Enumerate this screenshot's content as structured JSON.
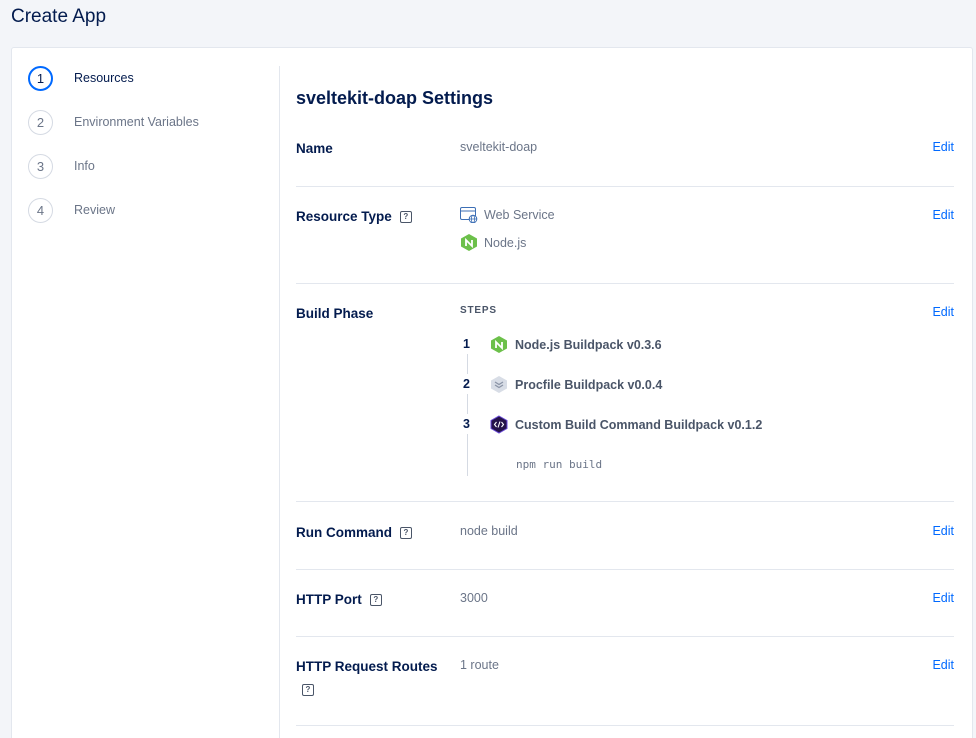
{
  "header": {
    "title": "Create App"
  },
  "wizard": {
    "steps": [
      {
        "number": "1",
        "label": "Resources"
      },
      {
        "number": "2",
        "label": "Environment Variables"
      },
      {
        "number": "3",
        "label": "Info"
      },
      {
        "number": "4",
        "label": "Review"
      }
    ]
  },
  "settings": {
    "title": "sveltekit-doap Settings",
    "edit_label": "Edit",
    "help_glyph": "?",
    "name": {
      "label": "Name",
      "value": "sveltekit-doap"
    },
    "resource_type": {
      "label": "Resource Type",
      "type": "Web Service",
      "runtime": "Node.js"
    },
    "build_phase": {
      "label": "Build Phase",
      "steps_heading": "STEPS",
      "buildpacks": [
        {
          "number": "1",
          "name": "Node.js Buildpack v0.3.6",
          "icon": "nodejs-icon"
        },
        {
          "number": "2",
          "name": "Procfile Buildpack v0.0.4",
          "icon": "procfile-icon"
        },
        {
          "number": "3",
          "name": "Custom Build Command Buildpack v0.1.2",
          "icon": "custom-build-icon"
        }
      ],
      "build_command": "npm run build"
    },
    "run_command": {
      "label": "Run Command",
      "value": "node build"
    },
    "http_port": {
      "label": "HTTP Port",
      "value": "3000"
    },
    "http_routes": {
      "label": "HTTP Request Routes",
      "value": "1 route"
    }
  },
  "colors": {
    "accent": "#0069ff",
    "text": "#031b4e",
    "muted": "#6b7588",
    "border": "#e3e7ee"
  }
}
